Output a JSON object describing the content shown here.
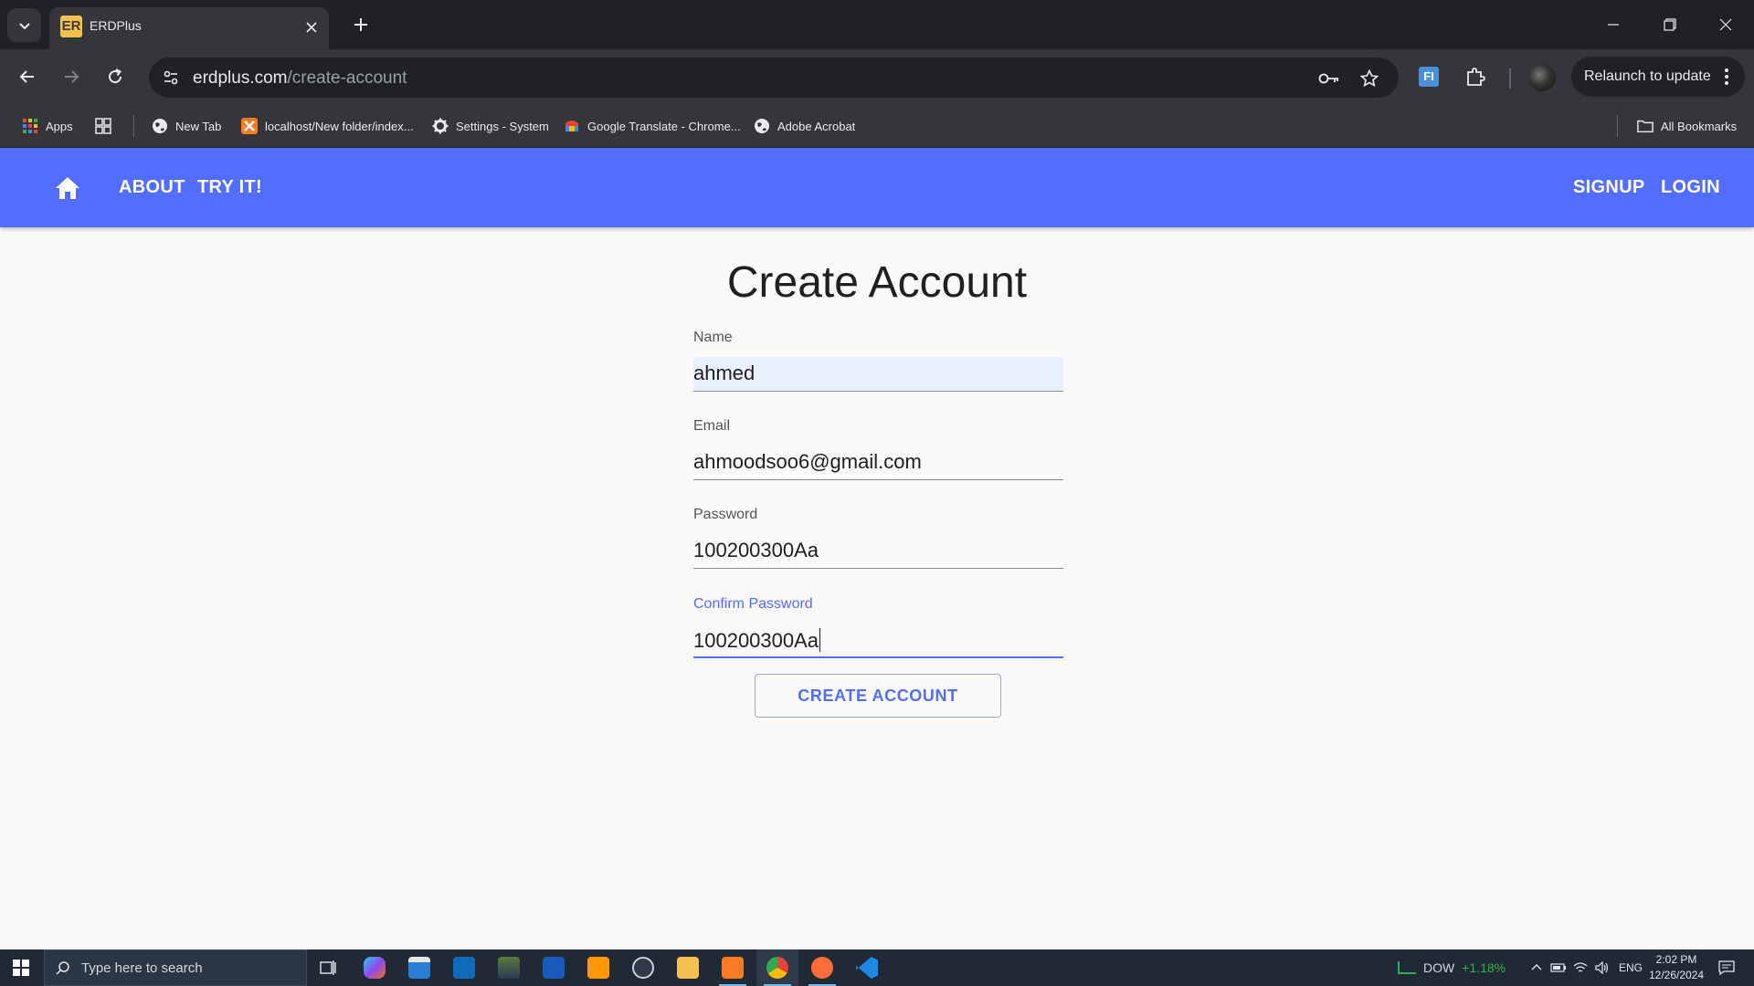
{
  "browser": {
    "tab_title": "ERDPlus",
    "favicon_text": "ER",
    "url_host": "erdplus.com",
    "url_path": "/create-account",
    "relaunch_label": "Relaunch to update",
    "bookmarks": [
      {
        "label": "Apps",
        "icon": "apps-grid-icon"
      },
      {
        "label": "",
        "icon": "tab-groups-icon"
      },
      {
        "label": "New Tab",
        "icon": "globe-icon"
      },
      {
        "label": "localhost/New folder/index...",
        "icon": "xampp-icon"
      },
      {
        "label": "Settings - System",
        "icon": "gear-icon"
      },
      {
        "label": "Google Translate - Chrome...",
        "icon": "translate-icon"
      },
      {
        "label": "Adobe Acrobat",
        "icon": "globe-icon"
      }
    ],
    "all_bookmarks_label": "All Bookmarks"
  },
  "appbar": {
    "about": "ABOUT",
    "try_it": "TRY IT!",
    "signup": "SIGNUP",
    "login": "LOGIN"
  },
  "form": {
    "title": "Create Account",
    "name_label": "Name",
    "name_value": "ahmed",
    "email_label": "Email",
    "email_value": "ahmoodsoo6@gmail.com",
    "password_label": "Password",
    "password_value": "100200300Aa",
    "confirm_label": "Confirm Password",
    "confirm_value": "100200300Aa",
    "submit_label": "CREATE ACCOUNT"
  },
  "taskbar": {
    "search_placeholder": "Type here to search",
    "stock_name": "DOW",
    "stock_change": "+1.18%",
    "language": "ENG",
    "time": "2:02 PM",
    "date": "12/26/2024"
  },
  "colors": {
    "accent": "#536dfe",
    "chrome_dark": "#202124",
    "chrome_toolbar": "#35363a",
    "taskbar": "#1f2a36"
  }
}
